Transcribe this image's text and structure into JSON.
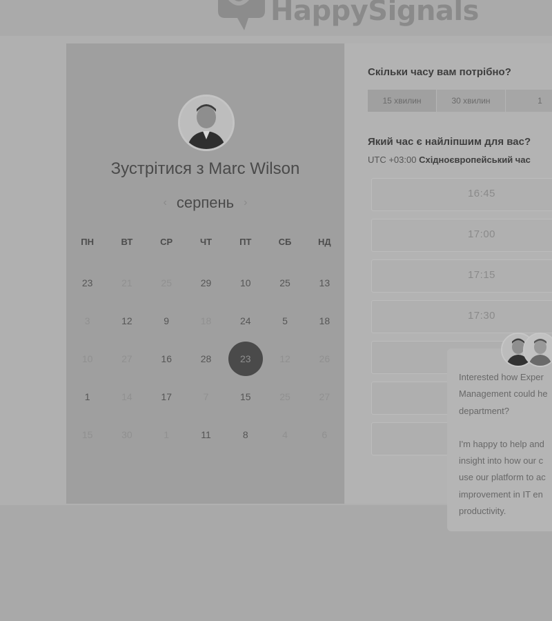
{
  "brand": {
    "name": "HappySignals"
  },
  "meeting": {
    "title": "Зустрітися з Marc Wilson",
    "month": "серпень"
  },
  "calendar": {
    "weekdays": [
      "ПН",
      "ВТ",
      "СР",
      "ЧТ",
      "ПТ",
      "СБ",
      "НД"
    ],
    "weeks": [
      [
        "23",
        "21",
        "25",
        "29",
        "10",
        "25",
        "13"
      ],
      [
        "3",
        "12",
        "9",
        "18",
        "24",
        "5",
        "18"
      ],
      [
        "10",
        "27",
        "16",
        "28",
        "23",
        "12",
        "26"
      ],
      [
        "1",
        "14",
        "17",
        "7",
        "15",
        "25",
        "27"
      ],
      [
        "15",
        "30",
        "1",
        "11",
        "8",
        "4",
        "6"
      ]
    ],
    "selected": "23"
  },
  "duration": {
    "question": "Скільки часу вам потрібно?",
    "options": [
      "15 хвилин",
      "30 хвилин",
      "1"
    ]
  },
  "time": {
    "question": "Який час є найліпшим для вас?",
    "timezone_prefix": "UTC +03:00",
    "timezone_name": "Східноєвропейський час",
    "slots": [
      "16:45",
      "17:00",
      "17:15",
      "17:30"
    ]
  },
  "chat": {
    "lines": [
      "Interested how Exper",
      "Management could he",
      "department?",
      "",
      "I'm happy to help and",
      "insight into how our c",
      "use our platform to ac",
      "improvement in IT en",
      "productivity."
    ]
  },
  "colors": {
    "selected_day": "#4a4a4a",
    "overlay": "#a9a9a9"
  }
}
